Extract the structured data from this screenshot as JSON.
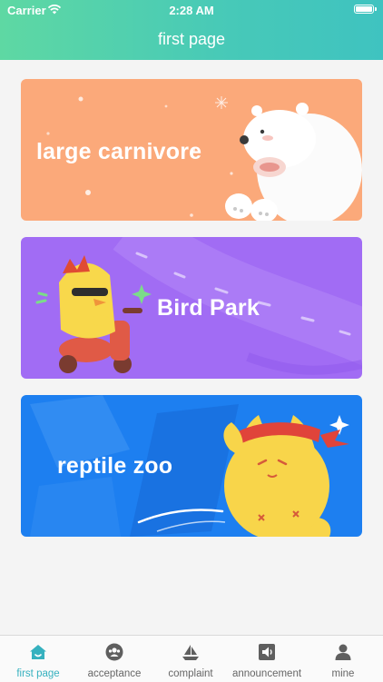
{
  "status_bar": {
    "carrier": "Carrier",
    "time": "2:28 AM"
  },
  "header": {
    "title": "first page"
  },
  "cards": [
    {
      "label": "large carnivore",
      "color": "#fba97a"
    },
    {
      "label": "Bird Park",
      "color": "#a16cf4"
    },
    {
      "label": "reptile zoo",
      "color": "#1d7ff0"
    }
  ],
  "tabbar": {
    "active_color": "#36b1bf",
    "tabs": [
      {
        "label": "first page",
        "icon": "home-icon",
        "active": true
      },
      {
        "label": "acceptance",
        "icon": "users-icon",
        "active": false
      },
      {
        "label": "complaint",
        "icon": "ship-icon",
        "active": false
      },
      {
        "label": "announcement",
        "icon": "speaker-icon",
        "active": false
      },
      {
        "label": "mine",
        "icon": "person-icon",
        "active": false
      }
    ]
  }
}
